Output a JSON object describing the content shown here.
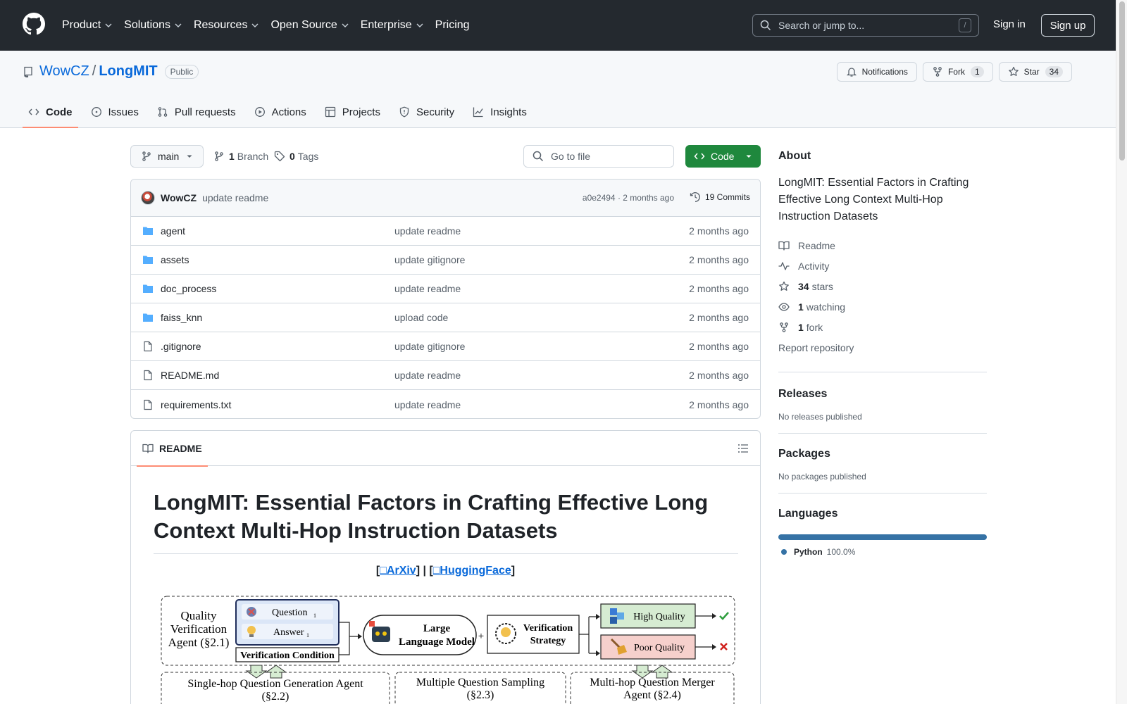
{
  "header": {
    "nav": [
      "Product",
      "Solutions",
      "Resources",
      "Open Source",
      "Enterprise",
      "Pricing"
    ],
    "search_placeholder": "Search or jump to...",
    "search_key": "/",
    "sign_in": "Sign in",
    "sign_up": "Sign up"
  },
  "repo": {
    "owner": "WowCZ",
    "separator": "/",
    "name": "LongMIT",
    "visibility": "Public",
    "notifications": "Notifications",
    "fork_label": "Fork",
    "fork_count": "1",
    "star_label": "Star",
    "star_count": "34",
    "tabs": [
      "Code",
      "Issues",
      "Pull requests",
      "Actions",
      "Projects",
      "Security",
      "Insights"
    ]
  },
  "filenav": {
    "branch": "main",
    "branch_count": "1",
    "branch_label": "Branch",
    "tag_count": "0",
    "tag_label": "Tags",
    "goto_file": "Go to file",
    "code_button": "Code"
  },
  "commit": {
    "author": "WowCZ",
    "message": "update readme",
    "meta": "a0e2494 · 2 months ago",
    "count": "19 Commits"
  },
  "files": [
    {
      "type": "folder",
      "name": "agent",
      "message": "update readme",
      "time": "2 months ago"
    },
    {
      "type": "folder",
      "name": "assets",
      "message": "update gitignore",
      "time": "2 months ago"
    },
    {
      "type": "folder",
      "name": "doc_process",
      "message": "update readme",
      "time": "2 months ago"
    },
    {
      "type": "folder",
      "name": "faiss_knn",
      "message": "upload code",
      "time": "2 months ago"
    },
    {
      "type": "file",
      "name": ".gitignore",
      "message": "update gitignore",
      "time": "2 months ago"
    },
    {
      "type": "file",
      "name": "README.md",
      "message": "update readme",
      "time": "2 months ago"
    },
    {
      "type": "file",
      "name": "requirements.txt",
      "message": "update readme",
      "time": "2 months ago"
    }
  ],
  "readme": {
    "tab_label": "README",
    "title": "LongMIT: Essential Factors in Crafting Effective Long Context Multi-Hop Instruction Datasets",
    "link_arxiv": "ArXiv",
    "link_hf": "HuggingFace",
    "diagram": {
      "qva": [
        "Quality",
        "Verification",
        "Agent (§2.1)"
      ],
      "question": "Question",
      "answer": "Answer",
      "subscript": "1",
      "condition": "Verification Condition",
      "llm": [
        "Large",
        "Language Model"
      ],
      "plus": "+",
      "strategy": [
        "Verification",
        "Strategy"
      ],
      "high": "High Quality",
      "poor": "Poor Quality",
      "single": [
        "Single-hop Question Generation Agent",
        "(§2.2)"
      ],
      "multiple": [
        "Multiple Question Sampling",
        "(§2.3)"
      ],
      "merger": [
        "Multi-hop Question Merger",
        "Agent (§2.4)"
      ]
    }
  },
  "sidebar": {
    "about": "About",
    "description": "LongMIT: Essential Factors in Crafting Effective Long Context Multi-Hop Instruction Datasets",
    "readme": "Readme",
    "activity": "Activity",
    "stars_count": "34",
    "stars_label": "stars",
    "watching_count": "1",
    "watching_label": "watching",
    "fork_count": "1",
    "fork_label": "fork",
    "report": "Report repository",
    "releases": "Releases",
    "releases_none": "No releases published",
    "packages": "Packages",
    "packages_none": "No packages published",
    "languages": "Languages",
    "lang_name": "Python",
    "lang_pct": "100.0%",
    "lang_color": "#3572a5"
  }
}
